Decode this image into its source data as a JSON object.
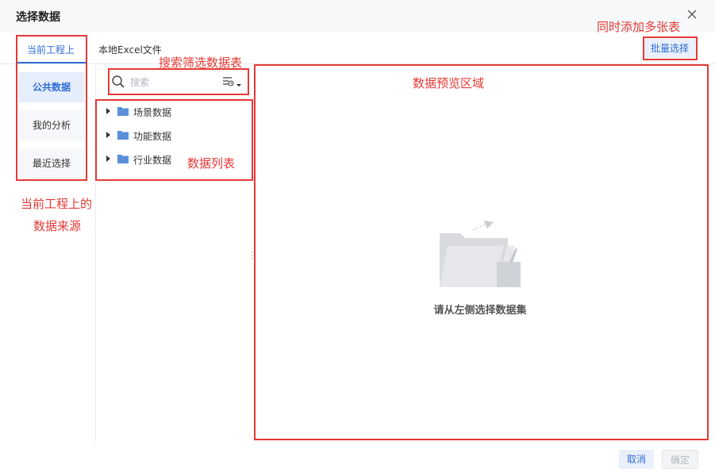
{
  "dialog": {
    "title": "选择数据"
  },
  "tabs": [
    {
      "label": "当前工程上"
    },
    {
      "label": "本地Excel文件"
    }
  ],
  "sidebar": {
    "items": [
      {
        "label": "公共数据"
      },
      {
        "label": "我的分析"
      },
      {
        "label": "最近选择"
      }
    ]
  },
  "search": {
    "placeholder": "搜索"
  },
  "tree": {
    "items": [
      {
        "label": "场景数据"
      },
      {
        "label": "功能数据"
      },
      {
        "label": "行业数据"
      }
    ]
  },
  "toolbar": {
    "batch_label": "批量选择"
  },
  "preview": {
    "empty_text": "请从左侧选择数据集"
  },
  "footer": {
    "cancel_label": "取消",
    "ok_label": "确定"
  },
  "annotations": {
    "batch_note": "同时添加多张表",
    "search_note": "搜索筛选数据表",
    "preview_note": "数据预览区域",
    "list_note": "数据列表",
    "source_note_line1": "当前工程上的",
    "source_note_line2": "数据来源"
  },
  "colors": {
    "accent": "#2f6cd6",
    "annotation_red": "#e53935",
    "folder_blue": "#5b8fd9"
  },
  "icons": {
    "close": "close-icon",
    "search": "search-icon",
    "filter": "filter-icon",
    "folder": "folder-icon",
    "caret": "caret-right-icon",
    "empty": "empty-folder-illustration"
  }
}
